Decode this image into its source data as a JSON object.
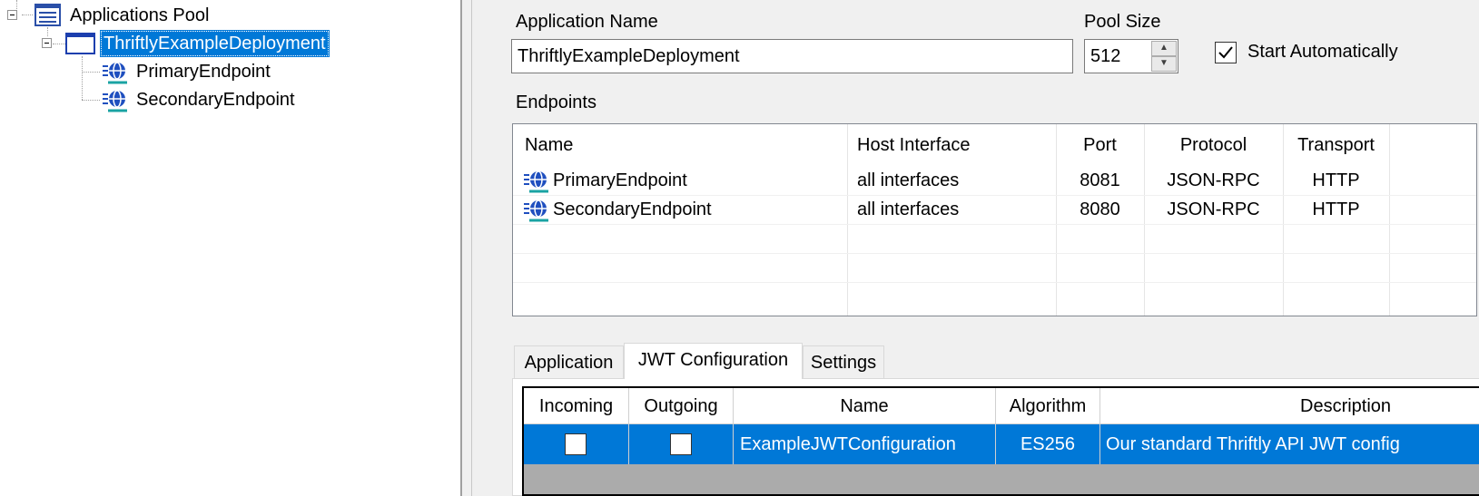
{
  "tree": {
    "root": {
      "label": "Applications Pool",
      "icon": "list-window-icon"
    },
    "deployment": {
      "label": "ThriftlyExampleDeployment",
      "icon": "window-icon",
      "selected": true
    },
    "endpoints": [
      {
        "label": "PrimaryEndpoint",
        "icon": "endpoint-globe-icon"
      },
      {
        "label": "SecondaryEndpoint",
        "icon": "endpoint-globe-icon"
      }
    ]
  },
  "form": {
    "app_name_label": "Application Name",
    "app_name_value": "ThriftlyExampleDeployment",
    "pool_size_label": "Pool Size",
    "pool_size_value": "512",
    "start_auto_label": "Start Automatically",
    "start_auto_checked": true,
    "endpoints_label": "Endpoints"
  },
  "endpoints_list": {
    "columns": [
      "Name",
      "Host Interface",
      "Port",
      "Protocol",
      "Transport"
    ],
    "rows": [
      {
        "name": "PrimaryEndpoint",
        "host": "all interfaces",
        "port": "8081",
        "protocol": "JSON-RPC",
        "transport": "HTTP"
      },
      {
        "name": "SecondaryEndpoint",
        "host": "all interfaces",
        "port": "8080",
        "protocol": "JSON-RPC",
        "transport": "HTTP"
      }
    ]
  },
  "tabs": [
    {
      "label": "Application",
      "active": false
    },
    {
      "label": "JWT Configuration",
      "active": true
    },
    {
      "label": "Settings",
      "active": false
    }
  ],
  "jwt_grid": {
    "columns": [
      "Incoming",
      "Outgoing",
      "Name",
      "Algorithm",
      "Description"
    ],
    "rows": [
      {
        "incoming": false,
        "outgoing": false,
        "name": "ExampleJWTConfiguration",
        "algorithm": "ES256",
        "description": "Our standard Thriftly API JWT config",
        "selected": true
      }
    ]
  },
  "colors": {
    "selection": "#0078d7",
    "panel_bg": "#f0f0f0",
    "grid_empty": "#ababab",
    "globe": "#1f4fbf",
    "globe_underline": "#1aa3a3"
  }
}
